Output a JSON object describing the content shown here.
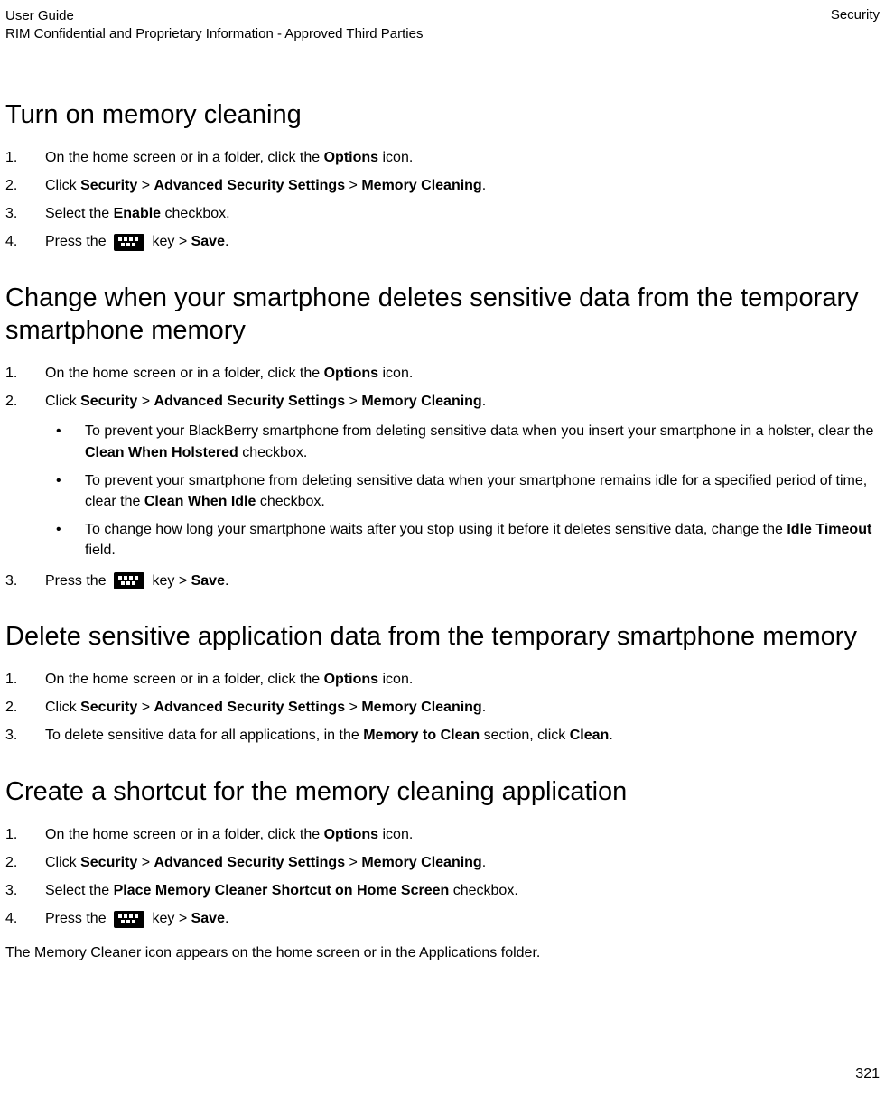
{
  "header": {
    "left_line1": "User Guide",
    "left_line2": "RIM Confidential and Proprietary Information - Approved Third Parties",
    "right": "Security"
  },
  "page_number": "321",
  "sections": {
    "s1": {
      "title": "Turn on memory cleaning",
      "step1_pre": "On the home screen or in a folder, click the ",
      "step1_bold": "Options",
      "step1_post": " icon.",
      "step2_pre": "Click ",
      "step2_b1": "Security",
      "step2_b2": "Advanced Security Settings",
      "step2_b3": "Memory Cleaning",
      "step3_pre": "Select the ",
      "step3_bold": "Enable",
      "step3_post": " checkbox.",
      "step4_pre": "Press the ",
      "step4_mid": " key > ",
      "step4_bold": "Save",
      "step4_post": "."
    },
    "s2": {
      "title": "Change when your smartphone deletes sensitive data from the temporary smartphone memory",
      "step1_pre": "On the home screen or in a folder, click the ",
      "step1_bold": "Options",
      "step1_post": " icon.",
      "step2_pre": "Click ",
      "step2_b1": "Security",
      "step2_b2": "Advanced Security Settings",
      "step2_b3": "Memory Cleaning",
      "b1_pre": "To prevent your BlackBerry smartphone from deleting sensitive data when you insert your smartphone in a holster, clear the ",
      "b1_bold": "Clean When Holstered",
      "b1_post": " checkbox.",
      "b2_pre": "To prevent your smartphone from deleting sensitive data when your smartphone remains idle for a specified period of time, clear the ",
      "b2_bold": "Clean When Idle",
      "b2_post": " checkbox.",
      "b3_pre": "To change how long your smartphone waits after you stop using it before it deletes sensitive data, change the ",
      "b3_bold": "Idle Timeout",
      "b3_post": " field.",
      "step3_pre": "Press the ",
      "step3_mid": " key > ",
      "step3_bold": "Save",
      "step3_post": "."
    },
    "s3": {
      "title": "Delete sensitive application data from the temporary smartphone memory",
      "step1_pre": "On the home screen or in a folder, click the ",
      "step1_bold": "Options",
      "step1_post": " icon.",
      "step2_pre": "Click ",
      "step2_b1": "Security",
      "step2_b2": "Advanced Security Settings",
      "step2_b3": "Memory Cleaning",
      "step3_pre": "To delete sensitive data for all applications, in the ",
      "step3_b1": "Memory to Clean",
      "step3_mid": " section, click ",
      "step3_b2": "Clean",
      "step3_post": "."
    },
    "s4": {
      "title": "Create a shortcut for the memory cleaning application",
      "step1_pre": "On the home screen or in a folder, click the ",
      "step1_bold": "Options",
      "step1_post": " icon.",
      "step2_pre": "Click ",
      "step2_b1": "Security",
      "step2_b2": "Advanced Security Settings",
      "step2_b3": "Memory Cleaning",
      "step3_pre": "Select the ",
      "step3_bold": "Place Memory Cleaner Shortcut on Home Screen",
      "step3_post": " checkbox.",
      "step4_pre": "Press the ",
      "step4_mid": " key > ",
      "step4_bold": "Save",
      "step4_post": ".",
      "footer": "The Memory Cleaner icon appears on the home screen or in the Applications folder."
    }
  }
}
